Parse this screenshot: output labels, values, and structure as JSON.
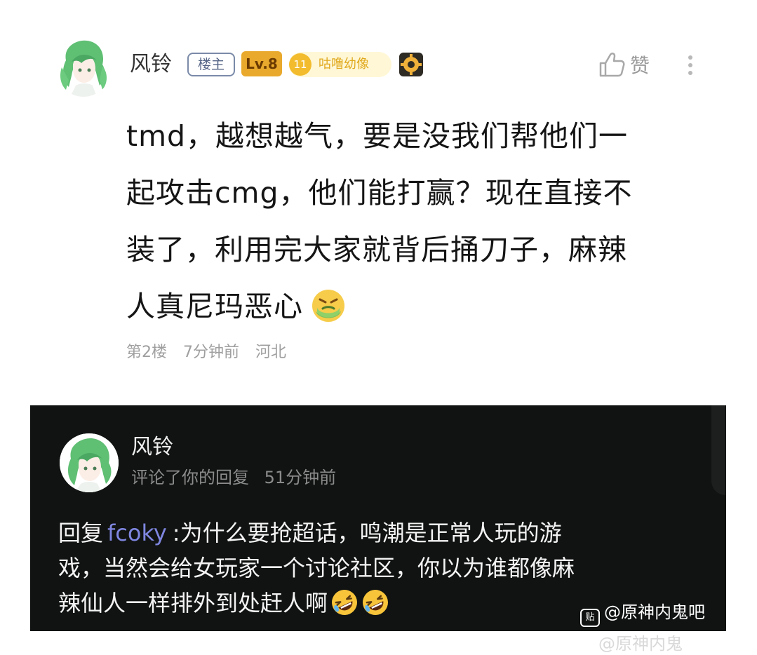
{
  "post": {
    "username": "风铃",
    "badge_owner": "楼主",
    "badge_level": "Lv.8",
    "badge_gem": "11",
    "badge_title": "咕噜幼像",
    "like_label": "赞",
    "content_lines": [
      "tmd，越想越气，要是没我们帮他们一",
      "起攻击cmg，他们能打赢？现在直接不",
      "装了，利用完大家就背后捅刀子，麻辣",
      "人真尼玛恶心"
    ],
    "floor": "第2楼",
    "time": "7分钟前",
    "location": "河北"
  },
  "notification": {
    "username": "风铃",
    "action": "评论了你的回复",
    "time": "51分钟前",
    "reply_prefix": "回复",
    "mention": "fcoky",
    "body_line1": ":为什么要抢超话，鸣潮是正常人玩的游",
    "body_line2": "戏，当然会给女玩家一个讨论社区，你以为谁都像麻",
    "body_line3": "辣仙人一样排外到处赶人啊"
  },
  "watermark": {
    "icon_text": "贴",
    "text": "@原神内鬼吧",
    "text2": "@原神内鬼"
  },
  "icons": {
    "avatar": "anime-girl-avatar-icon",
    "like": "thumbs-up-icon",
    "more": "more-vertical-icon",
    "gear": "gear-badge-icon",
    "emoji_sick": "nauseated-face-icon",
    "emoji_laugh": "rofl-face-icon"
  },
  "colors": {
    "card_bg": "#101311",
    "mention": "#7f86e0",
    "level_badge": "#e9a92c",
    "title_badge_text": "#e0a81b"
  }
}
